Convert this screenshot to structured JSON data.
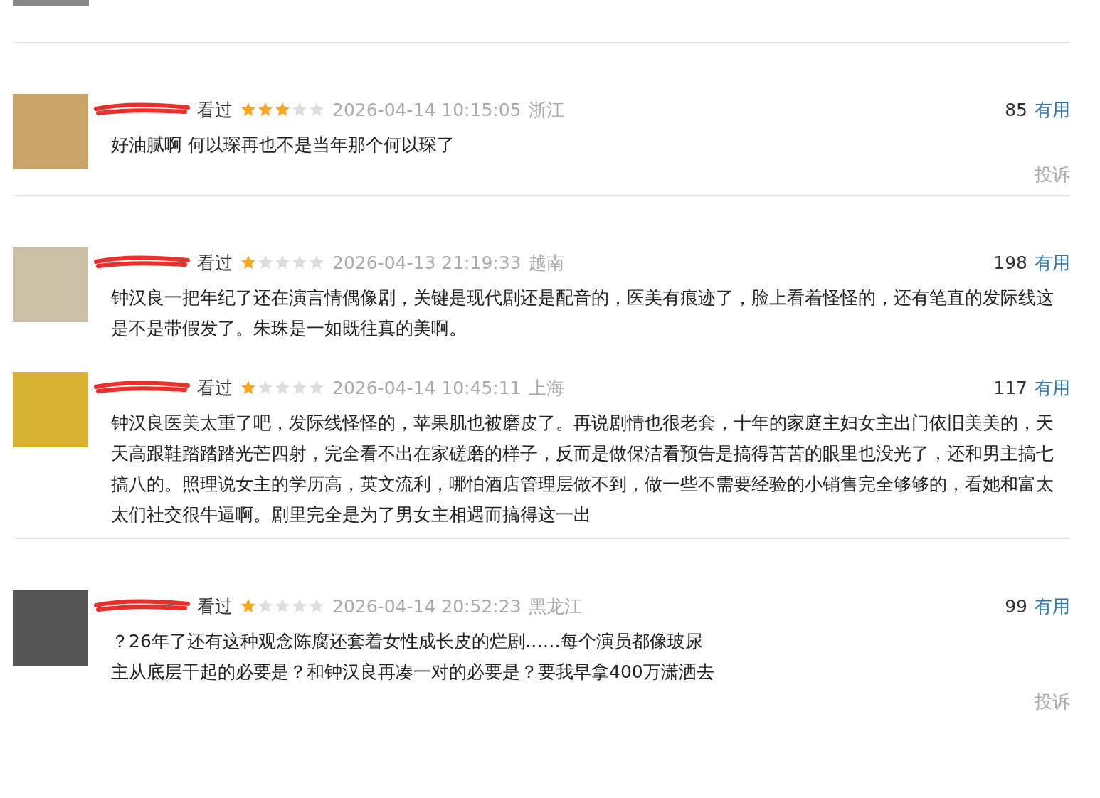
{
  "reviews": [
    {
      "status": "看过",
      "stars": 3,
      "time": "2026-04-14 10:15:05",
      "region": "浙江",
      "votes": "85",
      "vote_label": "有用",
      "comment": "好油腻啊 何以琛再也不是当年那个何以琛了",
      "report": "投诉",
      "divider": true
    },
    {
      "status": "看过",
      "stars": 1,
      "time": "2026-04-13 21:19:33",
      "region": "越南",
      "votes": "198",
      "vote_label": "有用",
      "comment": "钟汉良一把年纪了还在演言情偶像剧，关键是现代剧还是配音的，医美有痕迹了，脸上看着怪怪的，还有笔直的发际线这是不是带假发了。朱珠是一如既往真的美啊。",
      "divider": false
    },
    {
      "status": "看过",
      "stars": 1,
      "time": "2026-04-14 10:45:11",
      "region": "上海",
      "votes": "117",
      "vote_label": "有用",
      "comment": "钟汉良医美太重了吧，发际线怪怪的，苹果肌也被磨皮了。再说剧情也很老套，十年的家庭主妇女主出门依旧美美的，天天高跟鞋踏踏踏光芒四射，完全看不出在家磋磨的样子，反而是做保洁看预告是搞得苦苦的眼里也没光了，还和男主搞七搞八的。照理说女主的学历高，英文流利，哪怕酒店管理层做不到，做一些不需要经验的小销售完全够够的，看她和富太太们社交很牛逼啊。剧里完全是为了男女主相遇而搞得这一出",
      "divider": true
    },
    {
      "status": "看过",
      "stars": 1,
      "time": "2026-04-14 20:52:23",
      "region": "黑龙江",
      "votes": "99",
      "vote_label": "有用",
      "comment": "？26年了还有这种观念陈腐还套着女性成长皮的烂剧……每个演员都像玻尿",
      "comment_line2": "主从底层干起的必要是？和钟汉良再凑一对的必要是？要我早拿400万潇洒去",
      "report": "投诉",
      "divider": false
    }
  ]
}
